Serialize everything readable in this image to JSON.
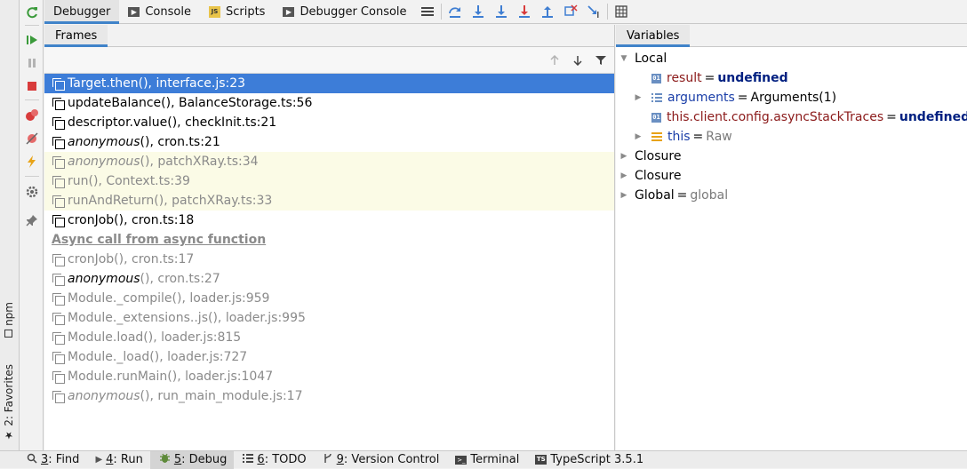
{
  "toolbar": {
    "tabs": [
      {
        "label": "Debugger",
        "icon": "debugger-icon"
      },
      {
        "label": "Console",
        "icon": "console-icon"
      },
      {
        "label": "Scripts",
        "icon": "scripts-icon"
      },
      {
        "label": "Debugger Console",
        "icon": "console-icon"
      }
    ]
  },
  "frames": {
    "header": "Frames",
    "rows": [
      {
        "fn": "Target.then()",
        "loc": ", interface.js:23",
        "kind": "selected"
      },
      {
        "fn": "updateBalance()",
        "loc": ", BalanceStorage.ts:56",
        "kind": "normal"
      },
      {
        "fn": "descriptor.value()",
        "loc": ", checkInit.ts:21",
        "kind": "normal"
      },
      {
        "fn": "anonymous",
        "fnSuffix": "()",
        "loc": ", cron.ts:21",
        "kind": "normal",
        "italic": true
      },
      {
        "fn": "anonymous",
        "fnSuffix": "()",
        "loc": ", patchXRay.ts:34",
        "kind": "library",
        "italic": true
      },
      {
        "fn": "run()",
        "loc": ", Context.ts:39",
        "kind": "library"
      },
      {
        "fn": "runAndReturn()",
        "loc": ", patchXRay.ts:33",
        "kind": "library"
      },
      {
        "fn": "cronJob()",
        "loc": ", cron.ts:18",
        "kind": "normal"
      }
    ],
    "async_label": "Async call from async function",
    "async_rows": [
      {
        "fn": "cronJob()",
        "loc": ", cron.ts:17"
      },
      {
        "fn": "anonymous",
        "fnSuffix": "()",
        "loc": ", cron.ts:27",
        "italic": true,
        "dark": true
      },
      {
        "fn": "Module._compile()",
        "loc": ", loader.js:959"
      },
      {
        "fn": "Module._extensions..js()",
        "loc": ", loader.js:995"
      },
      {
        "fn": "Module.load()",
        "loc": ", loader.js:815"
      },
      {
        "fn": "Module._load()",
        "loc": ", loader.js:727"
      },
      {
        "fn": "Module.runMain()",
        "loc": ", loader.js:1047"
      },
      {
        "fn": "anonymous",
        "fnSuffix": "()",
        "loc": ", run_main_module.js:17",
        "italic": true
      }
    ]
  },
  "variables": {
    "header": "Variables",
    "local_label": "Local",
    "result": {
      "name": "result",
      "value": "undefined"
    },
    "arguments": {
      "name": "arguments",
      "value": "Arguments(1)"
    },
    "async_traces": {
      "name": "this.client.config.asyncStackTraces",
      "value": "undefined"
    },
    "this_var": {
      "name": "this",
      "value": "Raw"
    },
    "closure1": "Closure",
    "closure2": "Closure",
    "global": {
      "name": "Global",
      "value": "global"
    }
  },
  "left_strip": {
    "npm": "npm",
    "favorites": "2: Favorites"
  },
  "statusbar": {
    "find": {
      "num": "3",
      "label": ": Find"
    },
    "run": {
      "num": "4",
      "label": ": Run"
    },
    "debug": {
      "num": "5",
      "label": ": Debug"
    },
    "todo": {
      "num": "6",
      "label": ": TODO"
    },
    "vcs": {
      "num": "9",
      "label": ": Version Control"
    },
    "terminal": "Terminal",
    "typescript": "TypeScript 3.5.1"
  },
  "colors": {
    "selection": "#3d7dd8",
    "library_bg": "#fbfbe6",
    "accent": "#4083c9"
  }
}
